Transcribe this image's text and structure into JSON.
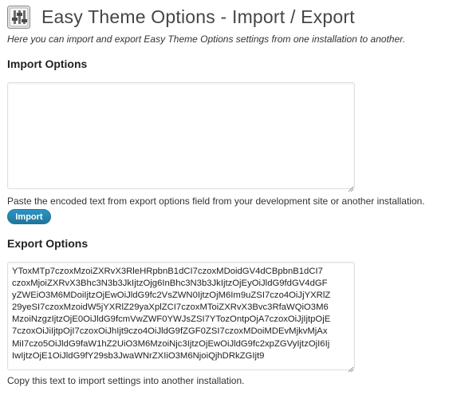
{
  "page": {
    "title": "Easy Theme Options - Import / Export",
    "intro": "Here you can import and export Easy Theme Options settings from one installation to another.",
    "icon": "settings-sliders-icon"
  },
  "import": {
    "title": "Import Options",
    "value": "",
    "hint": "Paste the encoded text from export options field from your development site or another installation.",
    "button_label": "Import"
  },
  "export": {
    "title": "Export Options",
    "lines": [
      "YToxMTp7czoxMzoiZXRvX3RleHRpbnB1dCI7czoxMDoidGV4dCBpbnB1dCI7",
      "czoxMjoiZXRvX3Bhc3N3b3JkIjtzOjg6InBhc3N3b3JkIjtzOjEyOiJldG9fdGV4dGF",
      "yZWEiO3M6MDoiIjtzOjEwOiJldG9fc2VsZWN0IjtzOjM6Im9uZSI7czo4OiJjYXRlZ",
      "29yeSI7czoxMzoidW5jYXRlZ29yaXplZCI7czoxMToiZXRvX3Bvc3RfaWQiO3M6",
      "MzoiNzgzIjtzOjE0OiJldG9fcmVwZWF0YWJsZSI7YTozOntpOjA7czoxOiJjIjtpOjE",
      "7czoxOiJiIjtpOjI7czoxOiJhIjt9czo4OiJldG9fZGF0ZSI7czoxMDoiMDEvMjkvMjAx",
      "MiI7czo5OiJldG9faW1hZ2UiO3M6MzoiNjc3IjtzOjEwOiJldG9fc2xpZGVyIjtzOjI6Ij",
      "IwIjtzOjE1OiJldG9fY29sb3JwaWNrZXIiO3M6NjoiQjhDRkZGIjt9"
    ],
    "hint": "Copy this text to import settings into another installation."
  }
}
